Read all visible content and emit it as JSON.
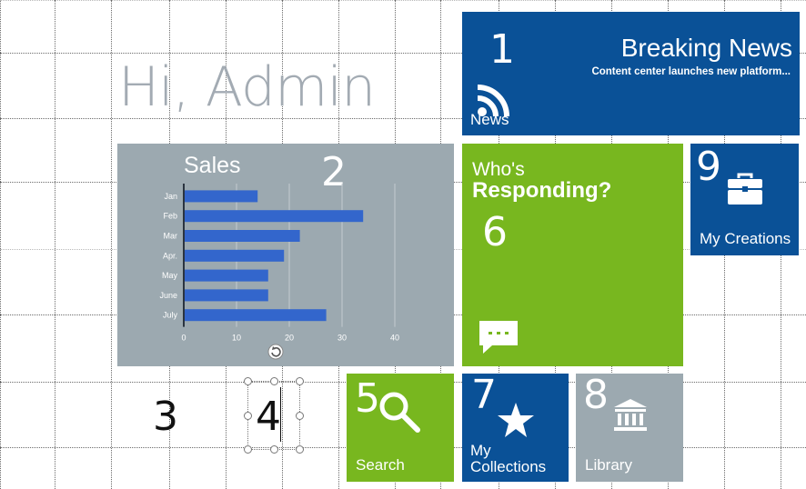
{
  "greeting": "Hi, Admin",
  "tiles": {
    "news": {
      "number": "1",
      "headline": "Breaking News",
      "ticker": "Content center launches new platform...",
      "label": "News",
      "icon": "rss-feed-icon",
      "color": "#0a5197"
    },
    "sales": {
      "number": "2",
      "title": "Sales",
      "color": "#9ca9b0"
    },
    "who": {
      "number": "6",
      "small_text": "Who's",
      "big_text": "Responding?",
      "icon": "chat-bubble-icon",
      "color": "#78b71f"
    },
    "creations": {
      "number": "9",
      "label": "My Creations",
      "icon": "briefcase-icon",
      "color": "#0a5197"
    },
    "search": {
      "number": "5",
      "label": "Search",
      "icon": "search-icon",
      "color": "#78b71f"
    },
    "collections": {
      "number": "7",
      "label": "My Collections",
      "icon": "star-icon",
      "color": "#0a5197"
    },
    "library": {
      "number": "8",
      "label": "Library",
      "icon": "library-building-icon",
      "color": "#9ca9b0"
    }
  },
  "loose_numbers": {
    "three": "3",
    "four": "4"
  },
  "chart_data": {
    "type": "bar",
    "orientation": "horizontal",
    "title": "Sales",
    "categories": [
      "Jan",
      "Feb",
      "Mar",
      "Apr.",
      "May",
      "June",
      "July"
    ],
    "values": [
      14,
      34,
      22,
      19,
      16,
      16,
      27
    ],
    "xlim": [
      0,
      45
    ],
    "xticks": [
      0,
      10,
      20,
      30,
      40
    ],
    "grid": true,
    "bar_color": "#3366cc"
  }
}
